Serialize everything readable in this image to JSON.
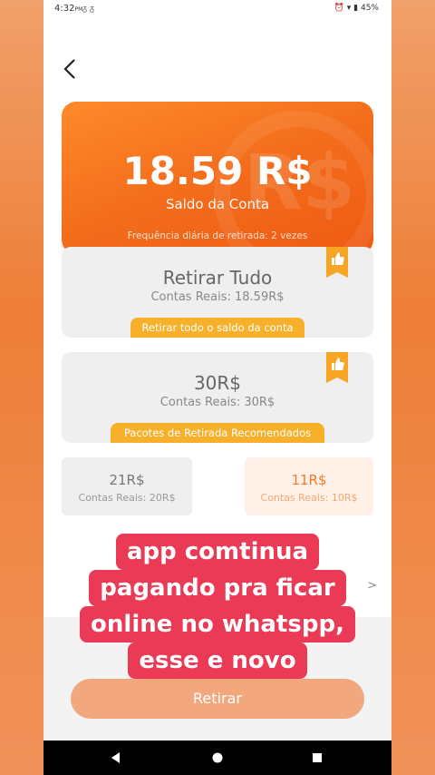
{
  "status": {
    "time": "4:32",
    "ampm": "PM",
    "notifs": "ᵹ ᵹ",
    "battery": "45%"
  },
  "balance": {
    "amount": "18.59 R$",
    "label": "Saldo da Conta",
    "frequency": "Frequência diária de retirada: 2 vezes",
    "watermark": "R$"
  },
  "options": [
    {
      "title": "Retirar Tudo",
      "sub": "Contas Reais: 18.59R$",
      "banner": "Retirar todo o saldo da conta"
    },
    {
      "title": "30R$",
      "sub": "Contas Reais: 30R$",
      "banner": "Pacotes de Retirada Recomendados"
    }
  ],
  "small_options": [
    {
      "title": "21R$",
      "sub": "Contas Reais: 20R$"
    },
    {
      "title": "11R$",
      "sub": "Contas Reais: 10R$"
    }
  ],
  "row2": {
    "chevron": ">"
  },
  "withdraw_button": {
    "label": "Retirar"
  },
  "overlay": {
    "lines": [
      "app comtinua",
      "pagando pra ficar",
      "online no whatspp,",
      "esse e novo"
    ]
  },
  "colors": {
    "accent": "#f36d1c",
    "banner": "#f6b02a",
    "overlay": "#ea3a55"
  }
}
